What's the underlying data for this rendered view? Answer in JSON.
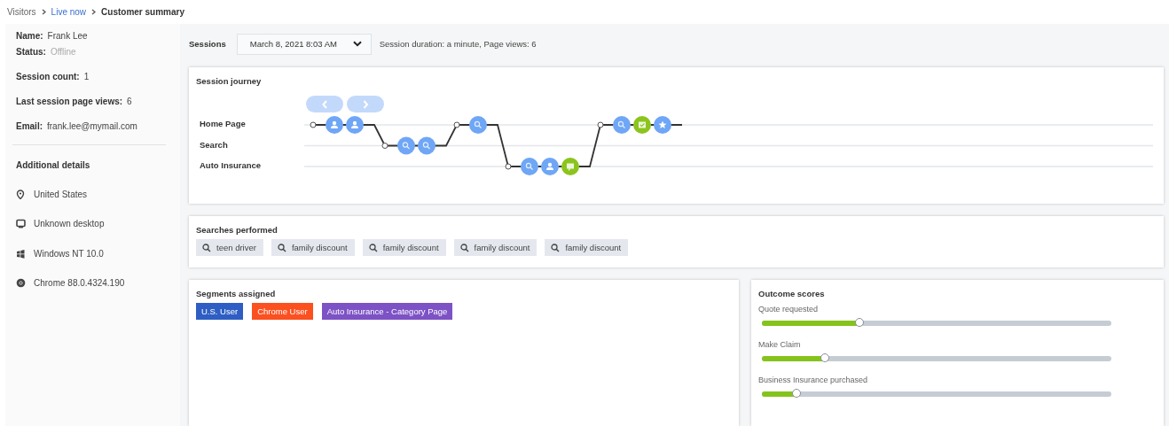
{
  "breadcrumb": [
    {
      "label": "Visitors",
      "kind": "link"
    },
    {
      "label": "Live now",
      "kind": "active-link"
    },
    {
      "label": "Customer summary",
      "kind": "current"
    }
  ],
  "sidebar": {
    "groups": [
      {
        "fields": [
          {
            "label": "Name:",
            "value": "Frank Lee",
            "muted": false
          },
          {
            "label": "Status:",
            "value": "Offline",
            "muted": true
          }
        ]
      },
      {
        "fields": [
          {
            "label": "Session count:",
            "value": "1",
            "muted": false
          }
        ]
      },
      {
        "fields": [
          {
            "label": "Last session page views:",
            "value": "6",
            "muted": false
          }
        ]
      },
      {
        "fields": [
          {
            "label": "Email:",
            "value": "frank.lee@mymail.com",
            "muted": false
          }
        ]
      }
    ],
    "details_title": "Additional details",
    "details": [
      {
        "kind": "location",
        "text": "United States"
      },
      {
        "kind": "device",
        "text": "Unknown desktop"
      },
      {
        "kind": "os",
        "text": "Windows NT 10.0"
      },
      {
        "kind": "browser",
        "text": "Chrome 88.0.4324.190"
      }
    ]
  },
  "sessions": {
    "label": "Sessions",
    "value": "March 8, 2021 8:03 AM",
    "info": "Session duration: a minute, Page views: 6"
  },
  "session_journey": {
    "title": "Session journey",
    "nav": [
      {
        "kind": "prev",
        "disabled": true
      },
      {
        "kind": "next",
        "disabled": true
      }
    ],
    "lanes": [
      {
        "label": "Home Page",
        "kind": "home"
      },
      {
        "label": "Search",
        "kind": "search"
      },
      {
        "label": "Auto Insurance",
        "kind": "product"
      }
    ],
    "visits": [
      {
        "kind": "home",
        "events": [
          {
            "kind": "person",
            "color": "#6fa6f6"
          },
          {
            "kind": "person",
            "color": "#6fa6f6"
          }
        ]
      },
      {
        "kind": "search",
        "events": [
          {
            "kind": "search",
            "color": "#6fa6f6"
          },
          {
            "kind": "search",
            "color": "#6fa6f6"
          }
        ]
      },
      {
        "kind": "home",
        "events": [
          {
            "kind": "search",
            "color": "#6fa6f6"
          }
        ]
      },
      {
        "kind": "product",
        "events": [
          {
            "kind": "search",
            "color": "#6fa6f6"
          },
          {
            "kind": "person",
            "color": "#6fa6f6"
          },
          {
            "kind": "chat",
            "color": "#8cc41e"
          }
        ]
      },
      {
        "kind": "home",
        "events": [
          {
            "kind": "search",
            "color": "#6fa6f6"
          },
          {
            "kind": "form",
            "color": "#8cc41e"
          },
          {
            "kind": "star",
            "color": "#6fa6f6"
          }
        ]
      }
    ]
  },
  "searches": {
    "title": "Searches performed",
    "terms": [
      "teen driver",
      "family discount",
      "family discount",
      "family discount",
      "family discount"
    ]
  },
  "segments": {
    "title": "Segments assigned",
    "tags": [
      {
        "label": "U.S. User",
        "color": "#2e5ec3"
      },
      {
        "label": "Chrome User",
        "color": "#fb5020"
      },
      {
        "label": "Auto Insurance - Category Page",
        "color": "#7d52c5"
      }
    ]
  },
  "outcomes": {
    "title": "Outcome scores",
    "scores": [
      {
        "label": "Quote requested",
        "level": 0.28
      },
      {
        "label": "Make Claim",
        "level": 0.18
      },
      {
        "label": "Business Insurance purchased",
        "level": 0.1
      }
    ]
  }
}
